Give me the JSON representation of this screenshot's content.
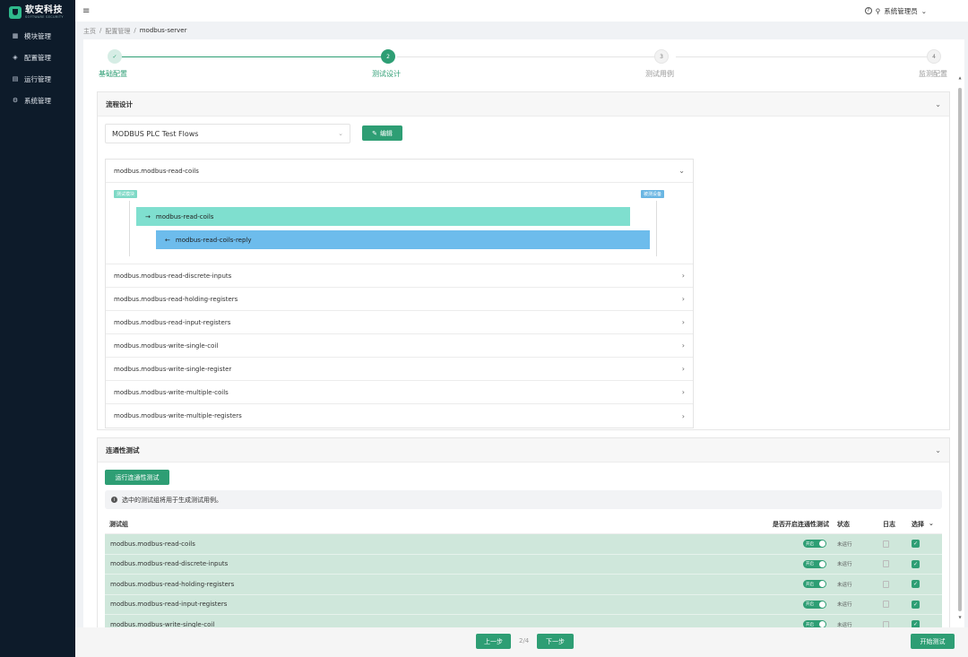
{
  "brand": {
    "name_cn": "软安科技",
    "name_en": "SOFTWARE SECURITY"
  },
  "sidebar": {
    "items": [
      {
        "label": "模块管理",
        "icon": "grid-icon"
      },
      {
        "label": "配置管理",
        "icon": "layers-icon"
      },
      {
        "label": "运行管理",
        "icon": "server-icon"
      },
      {
        "label": "系统管理",
        "icon": "gear-icon"
      }
    ]
  },
  "header": {
    "menu_icon": "≡",
    "user_name": "系统管理员"
  },
  "breadcrumb": {
    "items": [
      "主页",
      "配置管理"
    ],
    "current": "modbus-server",
    "separator": "/"
  },
  "steps": [
    {
      "num": "✓",
      "label": "基础配置",
      "state": "done"
    },
    {
      "num": "2",
      "label": "测试设计",
      "state": "active"
    },
    {
      "num": "3",
      "label": "测试用例",
      "state": "todo"
    },
    {
      "num": "4",
      "label": "监测配置",
      "state": "todo"
    }
  ],
  "flow_panel": {
    "title": "流程设计",
    "select_value": "MODBUS PLC Test Flows",
    "edit_label": "编辑",
    "expanded": {
      "name": "modbus.modbus-read-coils",
      "left_tag": "测试模块",
      "right_tag": "被测设备",
      "request": "modbus-read-coils",
      "reply": "modbus-read-coils-reply"
    },
    "rows": [
      "modbus.modbus-read-discrete-inputs",
      "modbus.modbus-read-holding-registers",
      "modbus.modbus-read-input-registers",
      "modbus.modbus-write-single-coil",
      "modbus.modbus-write-single-register",
      "modbus.modbus-write-multiple-coils",
      "modbus.modbus-write-multiple-registers"
    ]
  },
  "conn_panel": {
    "title": "连通性测试",
    "run_label": "运行连通性测试",
    "info": "选中的测试组将用于生成测试用例。",
    "columns": {
      "group": "测试组",
      "enabled": "是否开启连通性测试",
      "status": "状态",
      "log": "日志",
      "select": "选择"
    },
    "toggle_label": "开启",
    "status_text": "未运行",
    "rows": [
      "modbus.modbus-read-coils",
      "modbus.modbus-read-discrete-inputs",
      "modbus.modbus-read-holding-registers",
      "modbus.modbus-read-input-registers",
      "modbus.modbus-write-single-coil"
    ]
  },
  "footer": {
    "prev": "上一步",
    "page": "2/4",
    "next": "下一步",
    "start": "开始测试"
  },
  "colors": {
    "accent": "#2e9e74",
    "sidebar_bg": "#0d1b2a",
    "bar_request": "#7fdfcf",
    "bar_reply": "#6dbcec"
  }
}
